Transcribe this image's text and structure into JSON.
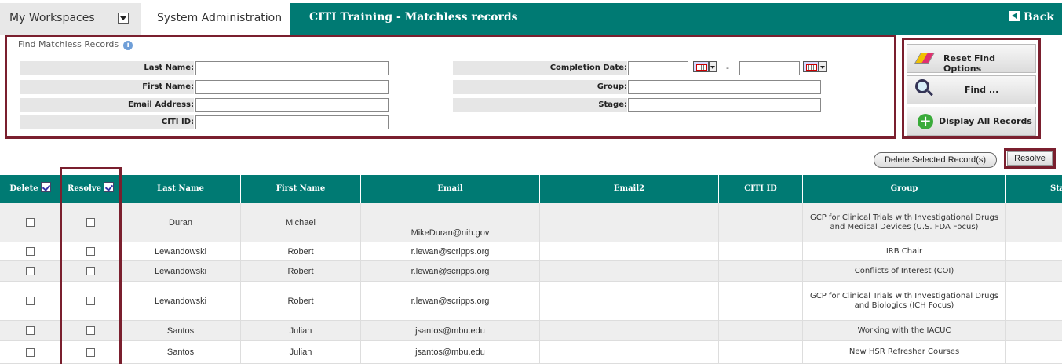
{
  "nav": {
    "workspaces_label": "My Workspaces",
    "sysadmin_label": "System Administration",
    "page_title": "CITI Training - Matchless records",
    "back_label": "Back"
  },
  "find": {
    "legend": "Find Matchless Records",
    "info_icon": "i",
    "last_name_label": "Last Name:",
    "first_name_label": "First Name:",
    "email_label": "Email Address:",
    "citi_id_label": "CITI ID:",
    "completion_date_label": "Completion Date:",
    "group_label": "Group:",
    "stage_label": "Stage:",
    "date_separator": "-"
  },
  "actions": {
    "reset_label": "Reset Find Options",
    "find_label": "Find ...",
    "display_all_label": "Display All Records",
    "plus_glyph": "+"
  },
  "table_actions": {
    "delete_selected_label": "Delete Selected Record(s)",
    "resolve_label": "Resolve"
  },
  "table": {
    "headers": {
      "delete": "Delete",
      "resolve": "Resolve",
      "last_name": "Last Name",
      "first_name": "First Name",
      "email": "Email",
      "email2": "Email2",
      "citi_id": "CITI ID",
      "group": "Group",
      "stage": "Stage"
    },
    "rows": [
      {
        "last": "Duran",
        "first": "Michael",
        "email": "MikeDuran@nih.gov",
        "email2": "",
        "citi_id": "",
        "group": "GCP for Clinical Trials with Investigational Drugs and Medical Devices (U.S. FDA Focus)",
        "stage": ""
      },
      {
        "last": "Lewandowski",
        "first": "Robert",
        "email": "r.lewan@scripps.org",
        "email2": "",
        "citi_id": "",
        "group": "IRB Chair",
        "stage": ""
      },
      {
        "last": "Lewandowski",
        "first": "Robert",
        "email": "r.lewan@scripps.org",
        "email2": "",
        "citi_id": "",
        "group": "Conflicts of Interest (COI)",
        "stage": ""
      },
      {
        "last": "Lewandowski",
        "first": "Robert",
        "email": "r.lewan@scripps.org",
        "email2": "",
        "citi_id": "",
        "group": "GCP for Clinical Trials with Investigational Drugs and Biologics (ICH Focus)",
        "stage": ""
      },
      {
        "last": "Santos",
        "first": "Julian",
        "email": "jsantos@mbu.edu",
        "email2": "",
        "citi_id": "",
        "group": "Working with the IACUC",
        "stage": ""
      },
      {
        "last": "Santos",
        "first": "Julian",
        "email": "jsantos@mbu.edu",
        "email2": "",
        "citi_id": "",
        "group": "New HSR Refresher Courses",
        "stage": ""
      }
    ]
  },
  "colors": {
    "accent": "#007a73",
    "highlight_border": "#7a1f2e",
    "row_alt": "#eeeeee"
  }
}
